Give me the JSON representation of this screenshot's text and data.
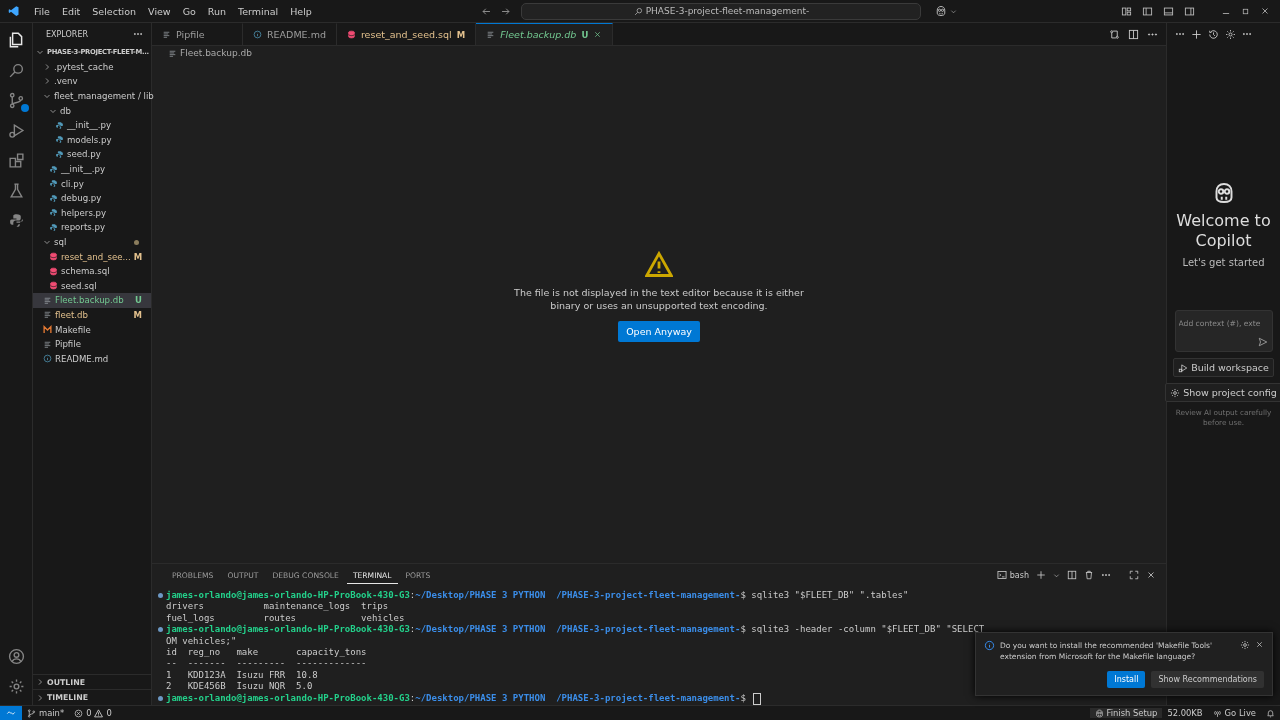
{
  "menu": [
    "File",
    "Edit",
    "Selection",
    "View",
    "Go",
    "Run",
    "Terminal",
    "Help"
  ],
  "command_center": "PHASE-3-project-fleet-management-",
  "explorer": {
    "title": "EXPLORER",
    "root": "PHASE-3-PROJECT-FLEET-M...",
    "items": [
      {
        "name": ".pytest_cache",
        "kind": "folder",
        "expanded": false
      },
      {
        "name": ".venv",
        "kind": "folder",
        "expanded": false
      },
      {
        "name": "fleet_management / lib",
        "kind": "folder",
        "expanded": true,
        "children": [
          {
            "name": "db",
            "kind": "folder",
            "expanded": true,
            "children": [
              {
                "name": "__init__.py",
                "kind": "python"
              },
              {
                "name": "models.py",
                "kind": "python"
              },
              {
                "name": "seed.py",
                "kind": "python"
              }
            ]
          },
          {
            "name": "__init__.py",
            "kind": "python"
          },
          {
            "name": "cli.py",
            "kind": "python"
          },
          {
            "name": "debug.py",
            "kind": "python"
          },
          {
            "name": "helpers.py",
            "kind": "python"
          },
          {
            "name": "reports.py",
            "kind": "python"
          }
        ]
      },
      {
        "name": "sql",
        "kind": "folder",
        "expanded": true,
        "has_changes": true,
        "children": [
          {
            "name": "reset_and_see...",
            "kind": "sql",
            "badge": "M",
            "color": "#e2c08d"
          },
          {
            "name": "schema.sql",
            "kind": "sql"
          },
          {
            "name": "seed.sql",
            "kind": "sql"
          }
        ]
      },
      {
        "name": "Fleet.backup.db",
        "kind": "text",
        "badge": "U",
        "color": "#73c991",
        "selected": true
      },
      {
        "name": "fleet.db",
        "kind": "text",
        "badge": "M",
        "color": "#e2c08d",
        "selected": false
      },
      {
        "name": "Makefile",
        "kind": "make"
      },
      {
        "name": "Pipfile",
        "kind": "text"
      },
      {
        "name": "README.md",
        "kind": "info"
      }
    ],
    "sections": [
      "OUTLINE",
      "TIMELINE"
    ]
  },
  "tabs": [
    {
      "label": "Pipfile",
      "kind": "text",
      "selected": false
    },
    {
      "label": "README.md",
      "kind": "info",
      "selected": false
    },
    {
      "label": "reset_and_seed.sql",
      "kind": "sql",
      "badge": "M",
      "color": "#e2c08d",
      "selected": false
    },
    {
      "label": "Fleet.backup.db",
      "kind": "text",
      "badge": "U",
      "color": "#73c991",
      "selected": true
    }
  ],
  "breadcrumb": "Fleet.backup.db",
  "editor": {
    "message": "The file is not displayed in the text editor because it is either binary or uses an unsupported text encoding.",
    "button": "Open Anyway"
  },
  "panel": {
    "tabs": [
      {
        "label": "PROBLEMS",
        "selected": false
      },
      {
        "label": "OUTPUT",
        "selected": false
      },
      {
        "label": "DEBUG CONSOLE",
        "selected": false
      },
      {
        "label": "TERMINAL",
        "selected": true
      },
      {
        "label": "PORTS",
        "selected": false
      }
    ],
    "shell": "bash",
    "lines": [
      {
        "kind": "prompt",
        "user": "james-orlando@james-orlando-HP-ProBook-430-G3",
        "sep": ":",
        "path": "~/Desktop/PHASE 3 PYTHON  /PHASE-3-project-fleet-management-",
        "symbol": "$",
        "command": "sqlite3 \"$FLEET_DB\" \".tables\""
      },
      {
        "kind": "output",
        "text": "drivers           maintenance_logs  trips"
      },
      {
        "kind": "output",
        "text": "fuel_logs         routes            vehicles"
      },
      {
        "kind": "prompt",
        "user": "james-orlando@james-orlando-HP-ProBook-430-G3",
        "sep": ":",
        "path": "~/Desktop/PHASE 3 PYTHON  /PHASE-3-project-fleet-management-",
        "symbol": "$",
        "command": "sqlite3 -header -column \"$FLEET_DB\" \"SELECT"
      },
      {
        "kind": "output",
        "text": "OM vehicles;\""
      },
      {
        "kind": "output",
        "text": "id  reg_no   make       capacity_tons"
      },
      {
        "kind": "output",
        "text": "--  -------  ---------  -------------"
      },
      {
        "kind": "output",
        "text": "1   KDD123A  Isuzu FRR  10.8"
      },
      {
        "kind": "output",
        "text": "2   KDE456B  Isuzu NQR  5.0"
      },
      {
        "kind": "prompt",
        "user": "james-orlando@james-orlando-HP-ProBook-430-G3",
        "sep": ":",
        "path": "~/Desktop/PHASE 3 PYTHON  /PHASE-3-project-fleet-management-",
        "symbol": "$",
        "cursor": true
      }
    ]
  },
  "copilot": {
    "title": "Welcome to Copilot",
    "subtitle": "Let's get started",
    "placeholder": "Add context (#), exte",
    "buttons": [
      "Build workspace",
      "Show project config"
    ],
    "note": "Review AI output carefully before use."
  },
  "notification": {
    "message": "Do you want to install the recommended 'Makefile Tools' extension from Microsoft for the Makefile language?",
    "buttons": [
      "Install",
      "Show Recommendations"
    ]
  },
  "status_bar": {
    "branch": "main*",
    "errors": "0",
    "warnings": "0",
    "right": [
      {
        "kind": "copilot",
        "text": "Finish Setup"
      },
      {
        "kind": "plain",
        "text": "52.00KB"
      },
      {
        "kind": "live",
        "text": "Go Live"
      }
    ]
  }
}
